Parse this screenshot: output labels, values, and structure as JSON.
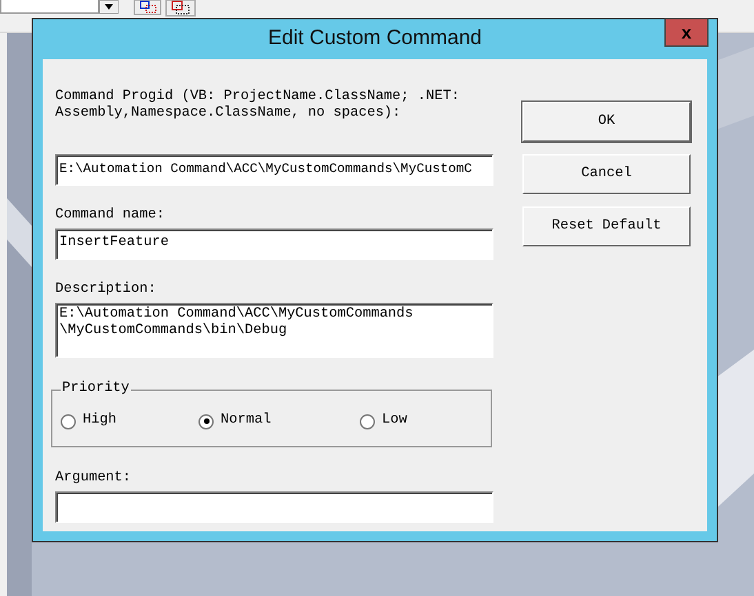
{
  "dialog": {
    "title": "Edit Custom Command",
    "close": "x"
  },
  "progid": {
    "label": "Command Progid (VB: ProjectName.ClassName; .NET: Assembly,Namespace.ClassName, no spaces):",
    "value": "E:\\Automation Command\\ACC\\MyCustomCommands\\MyCustomC"
  },
  "command_name": {
    "label": "Command name:",
    "value": "InsertFeature"
  },
  "description": {
    "label": "Description:",
    "value": "E:\\Automation Command\\ACC\\MyCustomCommands\n\\MyCustomCommands\\bin\\Debug"
  },
  "priority": {
    "label": "Priority",
    "options": [
      {
        "label": "High",
        "selected": false
      },
      {
        "label": "Normal",
        "selected": true
      },
      {
        "label": "Low",
        "selected": false
      }
    ]
  },
  "argument": {
    "label": "Argument:"
  },
  "buttons": [
    {
      "label": "OK",
      "default": true
    },
    {
      "label": "Cancel",
      "default": false
    },
    {
      "label": "Reset Default",
      "default": false
    }
  ]
}
